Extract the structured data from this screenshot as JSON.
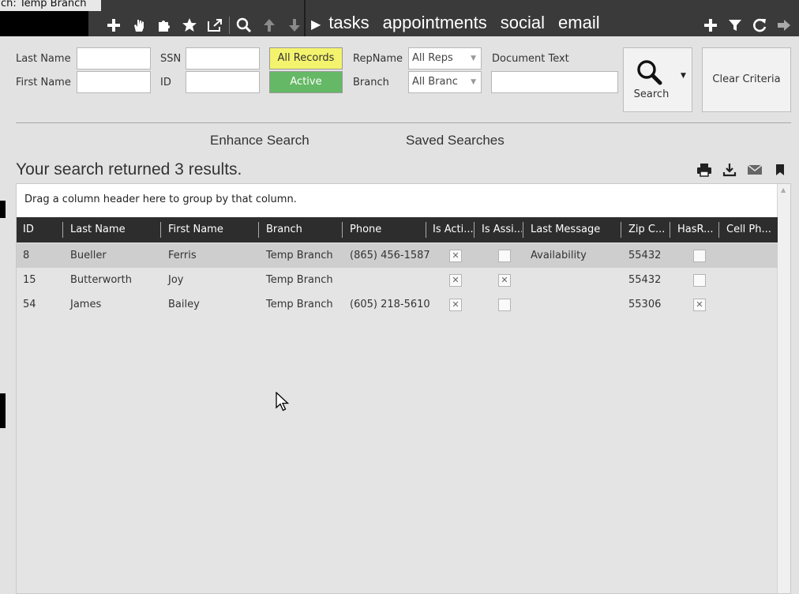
{
  "topbar": {
    "branch_label": "ch:  Temp Branch",
    "toolbar_icons": [
      "add-icon",
      "hand-icon",
      "puzzle-icon",
      "star-icon",
      "external-link-icon",
      "search-icon",
      "arrow-up-icon",
      "arrow-down-icon"
    ],
    "nav": [
      "tasks",
      "appointments",
      "social",
      "email"
    ],
    "right_icons": [
      "add-icon",
      "filter-icon",
      "refresh-icon",
      "arrow-right-icon"
    ]
  },
  "form": {
    "last_name_label": "Last Name",
    "first_name_label": "First Name",
    "last_name_value": "",
    "first_name_value": "",
    "ssn_label": "SSN",
    "id_label": "ID",
    "ssn_value": "",
    "id_value": "",
    "all_records_label": "All Records",
    "active_label": "Active",
    "repname_label": "RepName",
    "branch_label": "Branch",
    "repname_value": "All Reps",
    "branch_value": "All Branc",
    "document_text_label": "Document Text",
    "document_text_value": "",
    "search_label": "Search",
    "clear_label": "Clear Criteria"
  },
  "links": {
    "enhance": "Enhance Search",
    "saved": "Saved Searches"
  },
  "results": {
    "summary": "Your search returned 3 results.",
    "actions": [
      "print-icon",
      "download-icon",
      "email-icon",
      "bookmark-icon"
    ]
  },
  "grid": {
    "group_hint": "Drag a column header here to group by that column.",
    "columns": [
      "ID",
      "Last Name",
      "First Name",
      "Branch",
      "Phone",
      "Is Acti...",
      "Is Assi...",
      "Last Message",
      "Zip C...",
      "HasR...",
      "Cell Ph..."
    ],
    "rows": [
      {
        "id": "8",
        "last": "Bueller",
        "first": "Ferris",
        "branch": "Temp Branch",
        "phone": "(865) 456-1587",
        "active": true,
        "assigned": false,
        "last_message": "Availability",
        "zip": "55432",
        "hasr": false,
        "cell": ""
      },
      {
        "id": "15",
        "last": "Butterworth",
        "first": "Joy",
        "branch": "Temp Branch",
        "phone": "",
        "active": true,
        "assigned": true,
        "last_message": "",
        "zip": "55432",
        "hasr": false,
        "cell": ""
      },
      {
        "id": "54",
        "last": "James",
        "first": "Bailey",
        "branch": "Temp Branch",
        "phone": "(605) 218-5610",
        "active": true,
        "assigned": false,
        "last_message": "",
        "zip": "55306",
        "hasr": true,
        "cell": ""
      }
    ]
  },
  "colors": {
    "topbar": "#3a3a3a",
    "all_records": "#f4f36d",
    "active": "#65b865",
    "grid_header": "#2d2d2d"
  }
}
